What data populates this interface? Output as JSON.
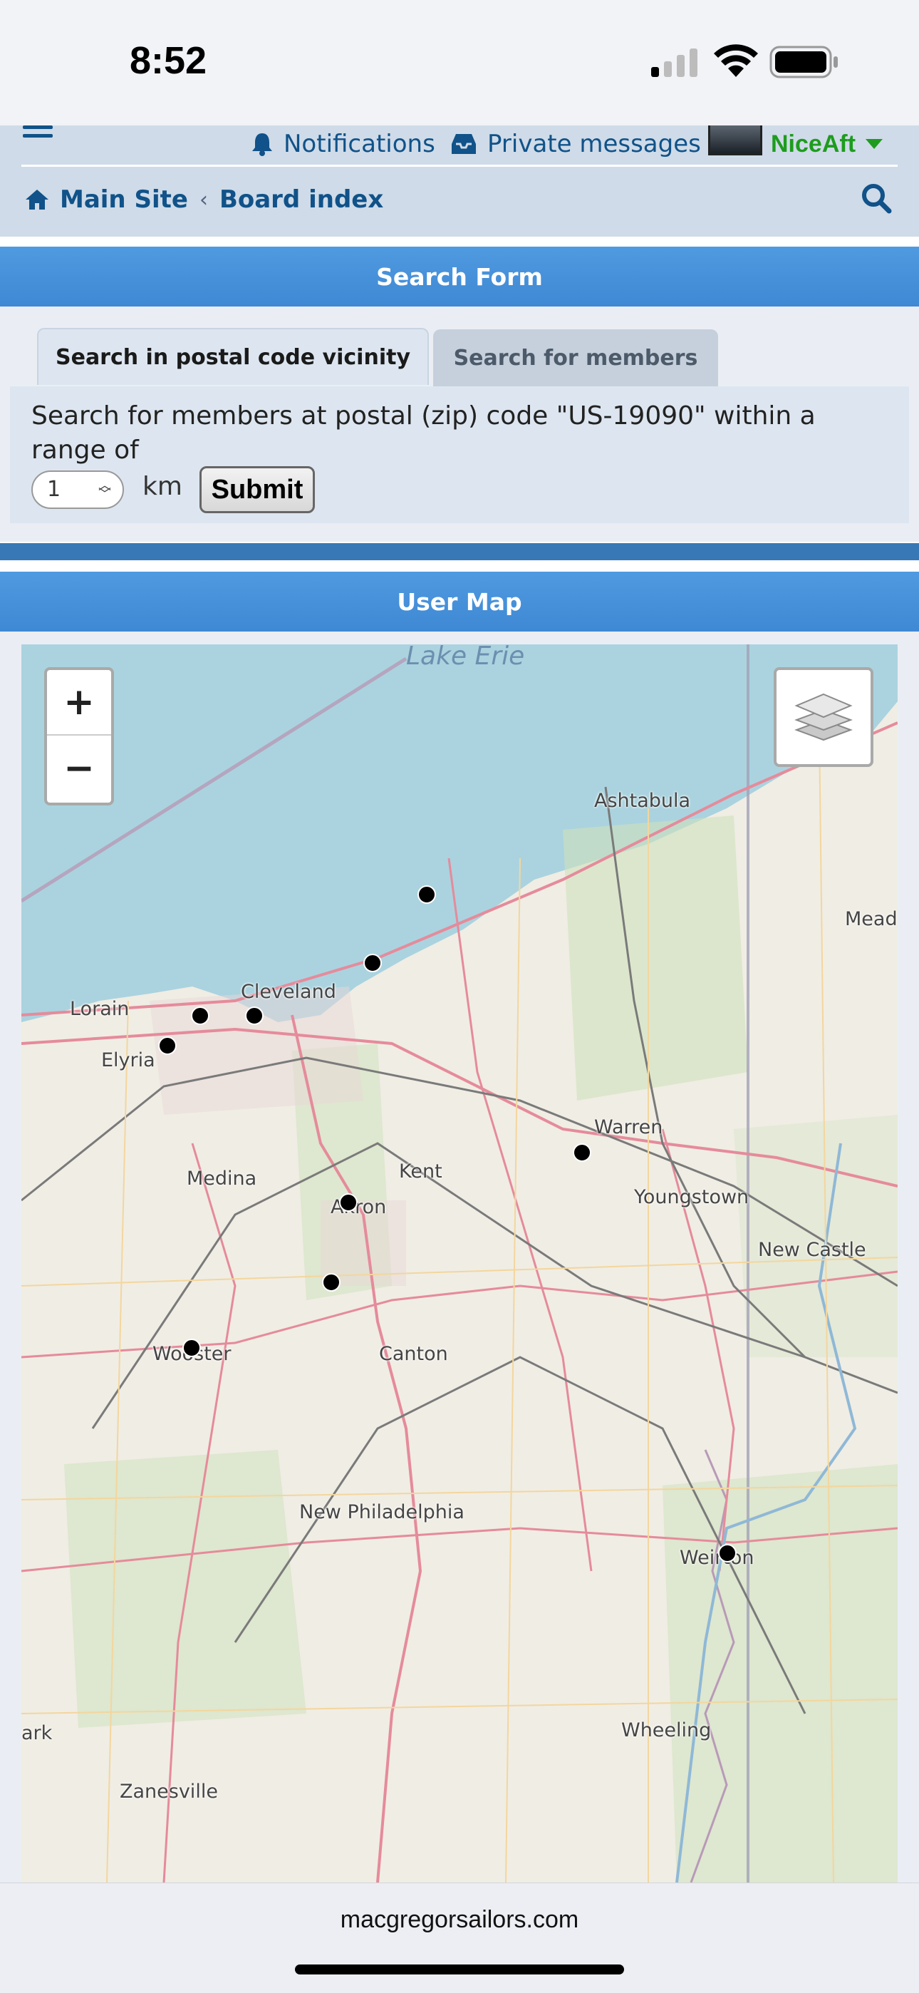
{
  "status_bar": {
    "time": "8:52"
  },
  "header": {
    "notifications_label": "Notifications",
    "private_messages_label": "Private messages",
    "username": "NiceAft",
    "breadcrumb": {
      "main_site": "Main Site",
      "board_index": "Board index"
    }
  },
  "search_form": {
    "title": "Search Form",
    "tabs": [
      {
        "label": "Search in postal code vicinity",
        "active": true
      },
      {
        "label": "Search for members",
        "active": false
      }
    ],
    "description": "Search for members at postal (zip) code \"US-19090\" within a range of",
    "range_value": "1",
    "unit": "km",
    "submit_label": "Submit"
  },
  "user_map": {
    "title": "User Map",
    "zoom_in_label": "+",
    "zoom_out_label": "−",
    "lake_label": "Lake Erie",
    "places": {
      "ashtabula": "Ashtabula",
      "mead": "Mead",
      "lorain": "Lorain",
      "cleveland": "Cleveland",
      "elyria": "Elyria",
      "warren": "Warren",
      "medina": "Medina",
      "kent": "Kent",
      "akron": "Akron",
      "youngstown": "Youngstown",
      "new_castle": "New Castle",
      "wooster": "Wooster",
      "canton": "Canton",
      "new_philadelphia": "New Philadelphia",
      "weirton": "Weirton",
      "ark": "ark",
      "wheeling": "Wheeling",
      "zanesville": "Zanesville"
    },
    "marker_count": 12
  },
  "browser": {
    "url": "macgregorsailors.com"
  },
  "colors": {
    "accent_blue": "#4a94dc",
    "link_blue": "#105289",
    "username_green": "#1e9c1e",
    "header_bg": "#cfdbe8",
    "map_water": "#aad3df"
  }
}
